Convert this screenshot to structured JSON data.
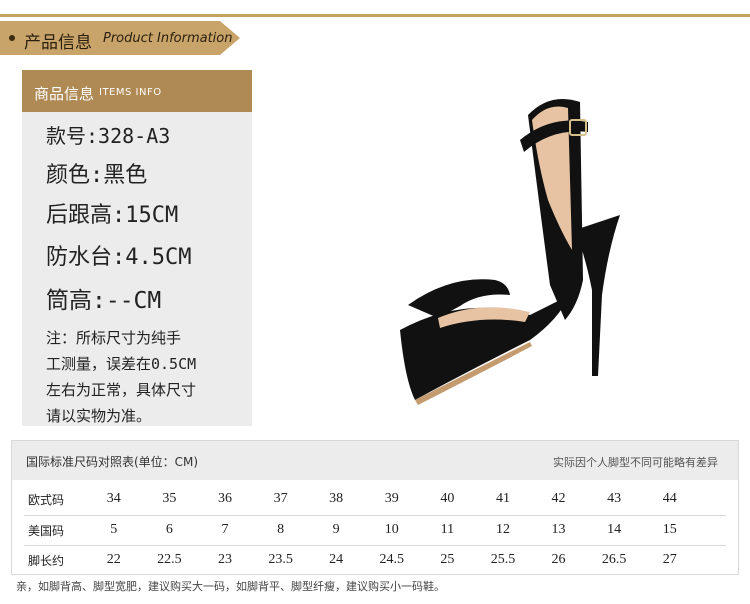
{
  "banner": {
    "cn": "产品信息",
    "en": "Product Information"
  },
  "info": {
    "header_cn": "商品信息",
    "header_en": "ITEMS INFO",
    "specs": [
      "款号:328-A3",
      "颜色:黑色",
      "后跟高:15CM",
      "防水台:4.5CM",
      "筒高:--CM"
    ],
    "note_lines": [
      "注：所标尺寸为纯手",
      "工测量，误差在0.5CM",
      "左右为正常，具体尺寸",
      "请以实物为准。"
    ]
  },
  "size_table": {
    "title": "国际标准尺码对照表(单位：CM)",
    "hint": "实际因个人脚型不同可能略有差异",
    "rows": [
      {
        "label": "欧式码",
        "values": [
          "34",
          "35",
          "36",
          "37",
          "38",
          "39",
          "40",
          "41",
          "42",
          "43",
          "44"
        ]
      },
      {
        "label": "美国码",
        "values": [
          "5",
          "6",
          "7",
          "8",
          "9",
          "10",
          "11",
          "12",
          "13",
          "14",
          "15"
        ]
      },
      {
        "label": "脚长约",
        "values": [
          "22",
          "22.5",
          "23",
          "23.5",
          "24",
          "24.5",
          "25",
          "25.5",
          "26",
          "26.5",
          "27"
        ]
      }
    ]
  },
  "footer": "亲，如脚背高、脚型宽肥，建议购买大一码，如脚背平、脚型纤瘦，建议购买小一码鞋。",
  "colors": {
    "gold": "#c9a46a",
    "header_brown": "#b08a55",
    "panel_gray": "#ececec",
    "shoe": "#111111"
  }
}
